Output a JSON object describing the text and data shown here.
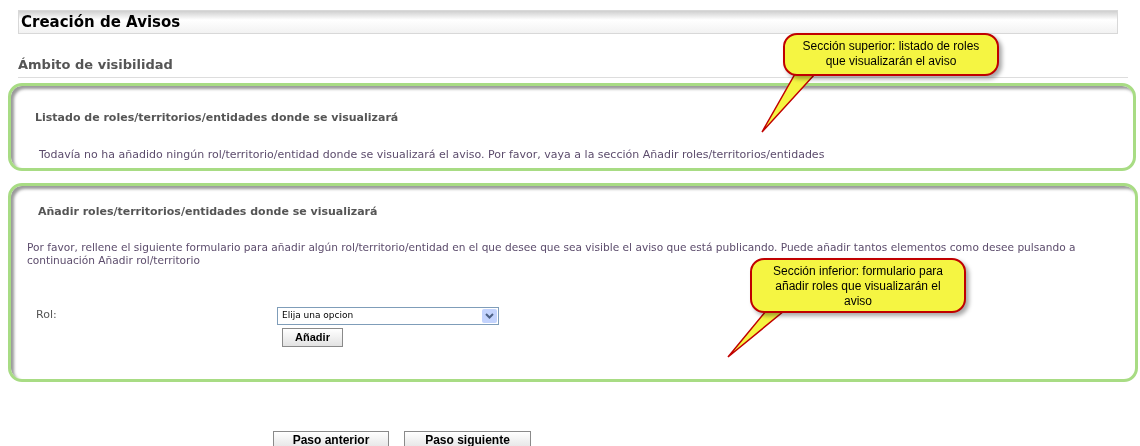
{
  "page_title": "Creación de Avisos",
  "section_heading": "Ámbito de visibilidad",
  "list_section": {
    "title": "Listado de roles/territorios/entidades donde se visualizará",
    "message": "Todavía no ha añadido ningún rol/territorio/entidad donde se visualizará el aviso. Por favor, vaya a la sección Añadir roles/territorios/entidades"
  },
  "add_section": {
    "title": "Añadir roles/territorios/entidades donde se visualizará",
    "instructions": "Por favor, rellene el siguiente formulario para añadir algún rol/territorio/entidad en el que desee que sea visible el aviso que está publicando. Puede añadir tantos elementos como desee pulsando a continuación Añadir rol/territorio",
    "role_label": "Rol:",
    "role_select": "Elija una opcion",
    "add_button": "Añadir"
  },
  "callouts": [
    {
      "text": "Sección superior: listado de roles que visualizarán el aviso"
    },
    {
      "text": "Sección inferior: formulario para añadir roles que visualizarán el aviso"
    }
  ],
  "nav_buttons": [
    "Paso anterior",
    "Paso siguiente"
  ]
}
